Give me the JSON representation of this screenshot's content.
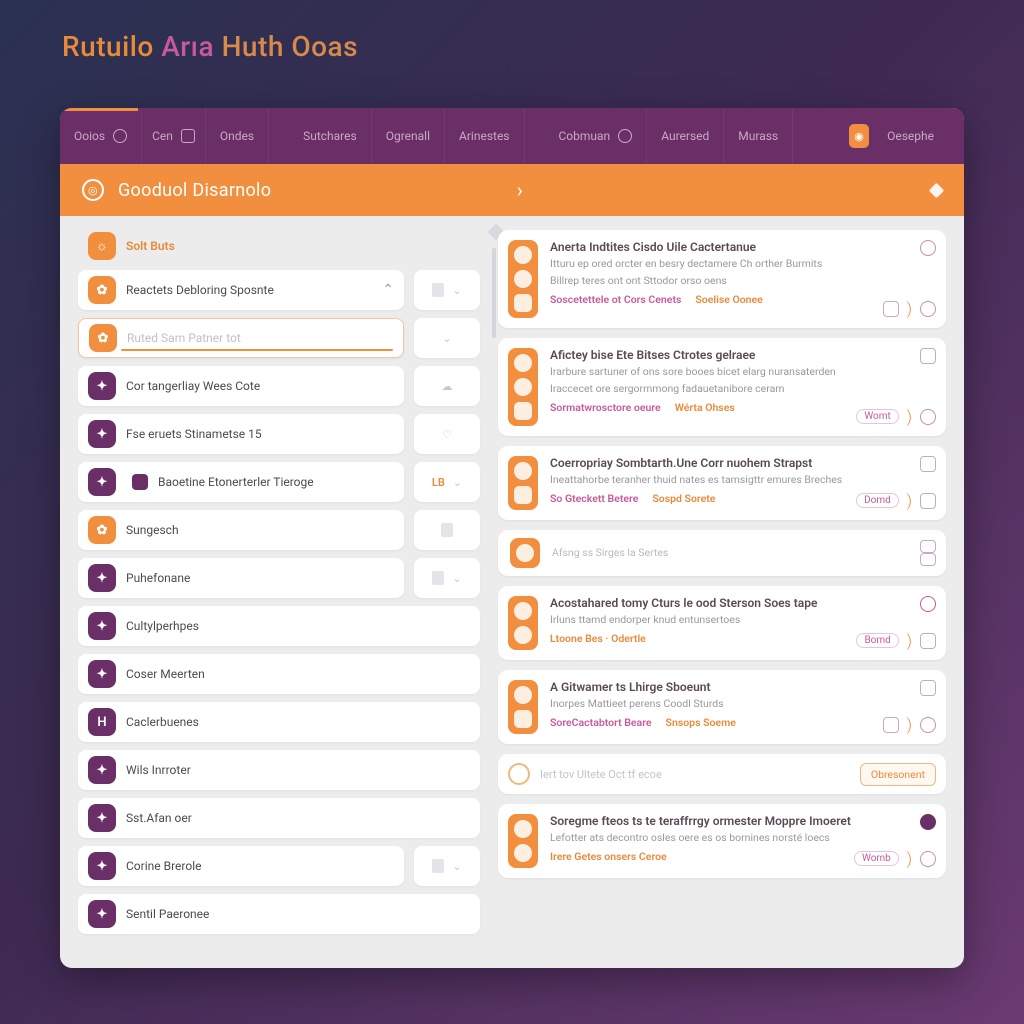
{
  "title": {
    "t1": "Rutuilo ",
    "t2": "Arıa ",
    "t3": "Huth Ooas"
  },
  "topnav": {
    "items": [
      "Ooios",
      "Cen",
      "Ondes",
      "Sutchares",
      "Ogrenall",
      "Arinestes",
      "Cobmuan",
      "Aurersed",
      "Murass"
    ],
    "right_label": "Oesephe"
  },
  "page_header": {
    "title": "Gooduol  Disarnolo"
  },
  "left": {
    "heading": "Solt Buts",
    "rows": [
      {
        "chip": "orange",
        "label": "Reactets Debloring Sposnte",
        "expand": true
      },
      {
        "chip": "orange",
        "label": "Ruted Sam Patner tot",
        "input": true
      },
      {
        "chip": "purple",
        "label": "Cor tangerliay Wees Cote",
        "aux_icon": "cloud"
      },
      {
        "chip": "purple",
        "label": "Fse eruets Stinametse 15",
        "aux_icon": "heart"
      },
      {
        "chip": "purple",
        "label": "Baoetine Etonerterler Tieroge",
        "mini": true,
        "aux_text": "LB"
      },
      {
        "chip": "orange",
        "label": "Sungesch"
      },
      {
        "chip": "purple",
        "label": "Puhefonane"
      },
      {
        "chip": "purple",
        "label": "Cultylperhpes"
      },
      {
        "chip": "purple",
        "label": "Coser Meerten"
      },
      {
        "chip": "purple",
        "label": "Caclerbuenes",
        "chip_text": "H"
      },
      {
        "chip": "purple",
        "label": "Wils Inrroter"
      },
      {
        "chip": "purple",
        "label": "Sst.Afan oer"
      },
      {
        "chip": "purple",
        "label": "Corine Brerole"
      },
      {
        "chip": "purple",
        "label": "Sentil Paeronee"
      }
    ]
  },
  "right": {
    "cards": [
      {
        "title": "Anerta Indtites Cisdo Uile Cactertanue",
        "l1": "Itturu ep ored orcter en besry dectamere Ch orther Burmits",
        "l2": "Billrep teres ont ont Sttodor orso oens",
        "meta1": "Soscetettele ot Cors Cenets",
        "meta2": "Soelise Oonee",
        "pill": ""
      },
      {
        "title": "Afictey bise Ete Bitses Ctrotes gelraee",
        "l1": "Irarbure sartuner of ons sore booes bicet elarg nuransaterden",
        "l2": "Iraccecet ore sergormmong fadauetanibore ceram",
        "meta1": "Sormatwrosctore oeure",
        "meta2": "Wérta Ohses",
        "pill": "Womt"
      },
      {
        "title": "Coerropriay Sombtarth.Une Corr nuohem Strapst",
        "l1": "Ineattahorbe teranher thuid nates es tamsigttr emures Breches",
        "meta1": "So Gteckett Betere",
        "meta2": "Sospd Sorete",
        "pill": "Domd"
      },
      {
        "slim": true,
        "title": "Afsng ss Sirges la Sertes"
      },
      {
        "title": "Acostahared tomy Cturs le ood Sterson Soes tape",
        "l1": "Irluns ttamd endorper knud entunsertoes",
        "meta1": "Ltoone Bes · Odertle",
        "pill": "Bomd"
      },
      {
        "title": "A Gitwamer ts Lhirge Sboeunt",
        "l1": "Inorpes Mattieet perens Coodl Sturds",
        "meta1": "SoreCactabtort Beare",
        "meta2": "Snsops Soeme",
        "pill": ""
      }
    ],
    "input": {
      "placeholder": "Iert tov Ultete Oct tf ecoe",
      "button": "Obresonent"
    },
    "last": {
      "title": "Soregme fteos ts te teraffrrgy ormester Moppre Imoeret",
      "l1": "Lefotter ats decontro osles oere es os bornines norsté loecs",
      "meta1": "Irere Getes onsers Ceroe",
      "pill": "Womb"
    }
  }
}
